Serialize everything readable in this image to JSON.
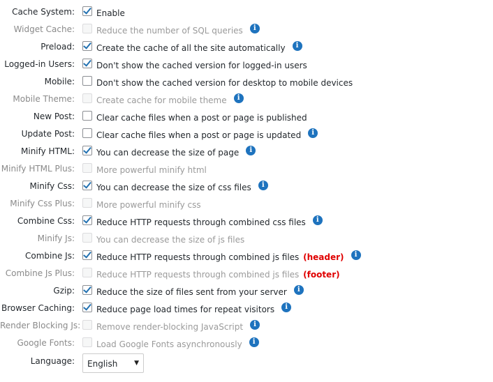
{
  "settings": [
    {
      "id": "cache-system",
      "label": "Cache System:",
      "checked": true,
      "disabled": false,
      "description": "Enable",
      "extra": "",
      "info": false
    },
    {
      "id": "widget-cache",
      "label": "Widget Cache:",
      "checked": false,
      "disabled": true,
      "description": "Reduce the number of SQL queries",
      "extra": "",
      "info": true
    },
    {
      "id": "preload",
      "label": "Preload:",
      "checked": true,
      "disabled": false,
      "description": "Create the cache of all the site automatically",
      "extra": "",
      "info": true
    },
    {
      "id": "logged-in-users",
      "label": "Logged-in Users:",
      "checked": true,
      "disabled": false,
      "description": "Don't show the cached version for logged-in users",
      "extra": "",
      "info": false
    },
    {
      "id": "mobile",
      "label": "Mobile:",
      "checked": false,
      "disabled": false,
      "description": "Don't show the cached version for desktop to mobile devices",
      "extra": "",
      "info": false
    },
    {
      "id": "mobile-theme",
      "label": "Mobile Theme:",
      "checked": false,
      "disabled": true,
      "description": "Create cache for mobile theme",
      "extra": "",
      "info": true
    },
    {
      "id": "new-post",
      "label": "New Post:",
      "checked": false,
      "disabled": false,
      "description": "Clear cache files when a post or page is published",
      "extra": "",
      "info": false
    },
    {
      "id": "update-post",
      "label": "Update Post:",
      "checked": false,
      "disabled": false,
      "description": "Clear cache files when a post or page is updated",
      "extra": "",
      "info": true
    },
    {
      "id": "minify-html",
      "label": "Minify HTML:",
      "checked": true,
      "disabled": false,
      "description": "You can decrease the size of page",
      "extra": "",
      "info": true
    },
    {
      "id": "minify-html-plus",
      "label": "Minify HTML Plus:",
      "checked": false,
      "disabled": true,
      "description": "More powerful minify html",
      "extra": "",
      "info": false
    },
    {
      "id": "minify-css",
      "label": "Minify Css:",
      "checked": true,
      "disabled": false,
      "description": "You can decrease the size of css files",
      "extra": "",
      "info": true
    },
    {
      "id": "minify-css-plus",
      "label": "Minify Css Plus:",
      "checked": false,
      "disabled": true,
      "description": "More powerful minify css",
      "extra": "",
      "info": false
    },
    {
      "id": "combine-css",
      "label": "Combine Css:",
      "checked": true,
      "disabled": false,
      "description": "Reduce HTTP requests through combined css files",
      "extra": "",
      "info": true
    },
    {
      "id": "minify-js",
      "label": "Minify Js:",
      "checked": false,
      "disabled": true,
      "description": "You can decrease the size of js files",
      "extra": "",
      "info": false
    },
    {
      "id": "combine-js",
      "label": "Combine Js:",
      "checked": true,
      "disabled": false,
      "description": "Reduce HTTP requests through combined js files",
      "extra": "(header)",
      "info": true
    },
    {
      "id": "combine-js-plus",
      "label": "Combine Js Plus:",
      "checked": false,
      "disabled": true,
      "description": "Reduce HTTP requests through combined js files",
      "extra": "(footer)",
      "info": false
    },
    {
      "id": "gzip",
      "label": "Gzip:",
      "checked": true,
      "disabled": false,
      "description": "Reduce the size of files sent from your server",
      "extra": "",
      "info": true
    },
    {
      "id": "browser-caching",
      "label": "Browser Caching:",
      "checked": true,
      "disabled": false,
      "description": "Reduce page load times for repeat visitors",
      "extra": "",
      "info": true
    },
    {
      "id": "render-blocking-js",
      "label": "Render Blocking Js:",
      "checked": false,
      "disabled": true,
      "description": "Remove render-blocking JavaScript",
      "extra": "",
      "info": true
    },
    {
      "id": "google-fonts",
      "label": "Google Fonts:",
      "checked": false,
      "disabled": true,
      "description": "Load Google Fonts asynchronously",
      "extra": "",
      "info": true
    }
  ],
  "info_glyph": "i",
  "language": {
    "label": "Language:",
    "value": "English",
    "arrow": "▼"
  },
  "colors": {
    "checkmark": "#2271b1",
    "info_icon": "#1e73be",
    "highlight_text": "#e00000",
    "disabled_text": "#9a9a9a"
  }
}
